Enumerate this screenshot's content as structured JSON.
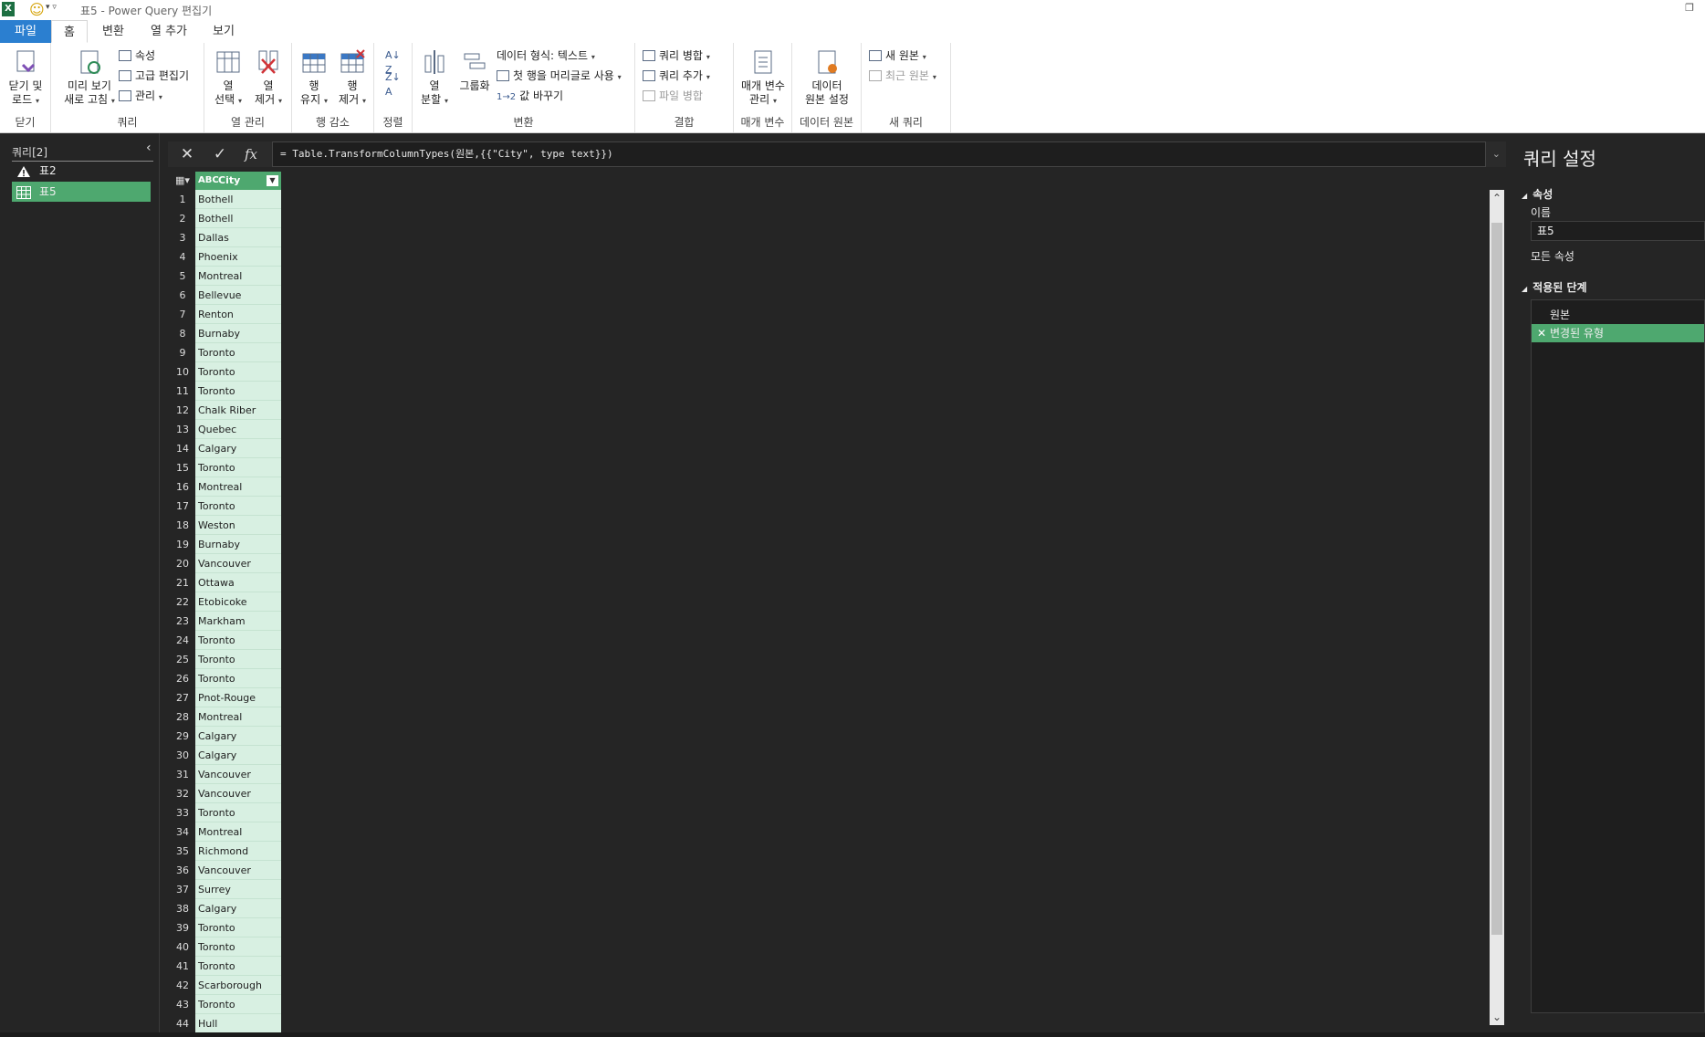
{
  "window": {
    "title": "표5 - Power Query 편집기"
  },
  "tabs": [
    "파일",
    "홈",
    "변환",
    "열 추가",
    "보기"
  ],
  "ribbon": {
    "close": {
      "label1": "닫기 및",
      "label2": "로드",
      "group": "닫기"
    },
    "query": {
      "refresh1": "미리 보기",
      "refresh2": "새로 고침",
      "properties": "속성",
      "advanced_editor": "고급 편집기",
      "manage": "관리",
      "group": "쿼리"
    },
    "columns": {
      "choose1": "열",
      "choose2": "선택",
      "remove1": "열",
      "remove2": "제거",
      "group": "열 관리"
    },
    "rows": {
      "keep1": "행",
      "keep2": "유지",
      "remove1": "행",
      "remove2": "제거",
      "group": "행 감소"
    },
    "sort": {
      "group": "정렬"
    },
    "transform": {
      "split1": "열",
      "split2": "분할",
      "groupby": "그룹화",
      "datatype": "데이터 형식: 텍스트",
      "first_row": "첫 행을 머리글로 사용",
      "replace": "값 바꾸기",
      "group": "변환"
    },
    "combine": {
      "merge": "쿼리 병합",
      "append": "쿼리 추가",
      "combine_files": "파일 병합",
      "group": "결합"
    },
    "params": {
      "manage1": "매개 변수",
      "manage2": "관리",
      "group": "매개 변수"
    },
    "datasource": {
      "settings1": "데이터",
      "settings2": "원본 설정",
      "group": "데이터 원본"
    },
    "newquery": {
      "new_source": "새 원본",
      "recent_sources": "최근 원본",
      "group": "새 쿼리"
    }
  },
  "queries": {
    "header": "쿼리[2]",
    "items": [
      {
        "name": "표2",
        "icon": "warning-icon",
        "selected": false
      },
      {
        "name": "표5",
        "icon": "table-icon",
        "selected": true
      }
    ]
  },
  "formula": {
    "cancel": "✕",
    "commit": "✓",
    "fx": "fx",
    "text": "= Table.TransformColumnTypes(원본,{{\"City\", type text}})"
  },
  "grid": {
    "column": {
      "type": "ABC",
      "name": "City"
    },
    "rows": [
      "Bothell",
      "Bothell",
      "Dallas",
      "Phoenix",
      "Montreal",
      "Bellevue",
      "Renton",
      "Burnaby",
      "Toronto",
      "Toronto",
      "Toronto",
      "Chalk Riber",
      "Quebec",
      "Calgary",
      "Toronto",
      "Montreal",
      "Toronto",
      "Weston",
      "Burnaby",
      "Vancouver",
      "Ottawa",
      "Etobicoke",
      "Markham",
      "Toronto",
      "Toronto",
      "Toronto",
      "Pnot-Rouge",
      "Montreal",
      "Calgary",
      "Calgary",
      "Vancouver",
      "Vancouver",
      "Toronto",
      "Montreal",
      "Richmond",
      "Vancouver",
      "Surrey",
      "Calgary",
      "Toronto",
      "Toronto",
      "Toronto",
      "Scarborough",
      "Toronto",
      "Hull"
    ]
  },
  "settings": {
    "title": "쿼리 설정",
    "properties": "속성",
    "name_label": "이름",
    "name_value": "표5",
    "all_properties": "모든 속성",
    "applied_steps": "적용된 단계",
    "steps": [
      {
        "name": "원본",
        "selected": false
      },
      {
        "name": "변경된 유형",
        "selected": true
      }
    ]
  },
  "colors": {
    "accent_green": "#4ea86f",
    "file_tab": "#2b7fd0",
    "dark_bg": "#252525"
  }
}
